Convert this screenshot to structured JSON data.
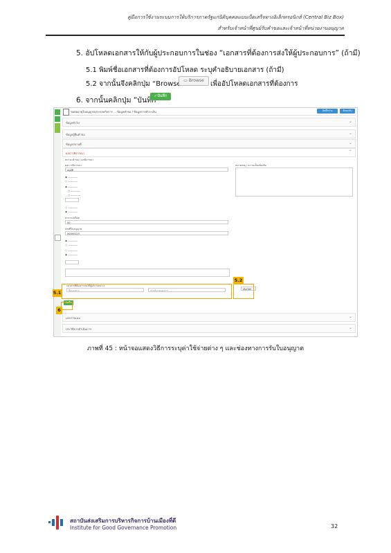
{
  "header": {
    "line1": "คู่มือการใช้งานระบบการให้บริการภาครัฐแก่นิติบุคคลแบบเบ็ดเสร็จทางอิเล็กทรอนิกส์ (Central Biz Box)",
    "line2": "สำหรับเจ้าหน้าที่ศูนย์รับคำขอและเจ้าหน้าที่หน่วยงานอนุญาต"
  },
  "steps": {
    "s5": "5. อัปโหลดเอกสารให้กับผู้ประกอบการในช่อง “เอกสารที่ต้องการส่งให้ผู้ประกอบการ” (ถ้ามี)",
    "s51": "5.1 พิมพ์ชื่อเอกสารที่ต้องการอัปโหลด ระบุคำอธิบายเอกสาร (ถ้ามี)",
    "s52a": "5.2 จากนั้นจึงคลิกปุ่ม “Browse”",
    "browse_label": "Browse",
    "s52b": "เพื่ออัปโหลดเอกสารที่ต้องการ",
    "s6": "6. จากนั้นคลิกปุ่ม “บันทึก”",
    "save_label": "บันทึก"
  },
  "screenshot": {
    "title": "ขอต่ออายุใบอนุญาตประกอบกิจการ ... ข้อมูลคำขอ / ข้อมูลการชำระเงิน",
    "btn1": "บันทึกร่าง",
    "btn2": "ย้อนกลับ",
    "sections": [
      "ข้อมูลทั่วไป",
      "ข้อมูลผู้ยื่นคำขอ",
      "ข้อมูลสถานที่",
      "ผลการพิจารณา",
      "เอกสารแนบ",
      "ประวัติการดำเนินการ"
    ],
    "form": {
      "status_label": "สถานะคำขอ / ผลพิจารณา",
      "select_label": "ผลการพิจารณา",
      "select_value": "อนุมัติ",
      "note_label": "หมายเหตุ / ความเห็นเพิ่มเติม",
      "fee_label": "ค่าธรรมเนียม",
      "fee_value": "00",
      "license_label": "เลขที่ใบอนุญาต",
      "license_value": "00000123",
      "doc_label": "เอกสารที่ต้องการส่งให้ผู้ประกอบการ",
      "doc_name_ph": "ชื่อเอกสาร",
      "doc_desc_ph": "คำอธิบายเอกสาร",
      "browse": "เลือกไฟล์",
      "save": "บันทึก"
    }
  },
  "callouts": {
    "c51": "5.1",
    "c52": "5.2",
    "c6": "6"
  },
  "caption": "ภาพที่ 45 : หน้าจอแสดงวิธีการระบุค่าใช้จ่ายต่าง ๆ และช่องทางการรับใบอนุญาต",
  "footer": {
    "org_th": "สถาบันส่งเสริมการบริหารกิจการบ้านเมืองที่ดี",
    "org_en": "Institute for Good Governance Promotion",
    "page": "32"
  },
  "colors": {
    "accent_green": "#4caf50",
    "callout": "#f5b400",
    "brand_purple": "#3d2a5e",
    "logo_blue": "#1f6fb8",
    "logo_red": "#d32f2f"
  }
}
